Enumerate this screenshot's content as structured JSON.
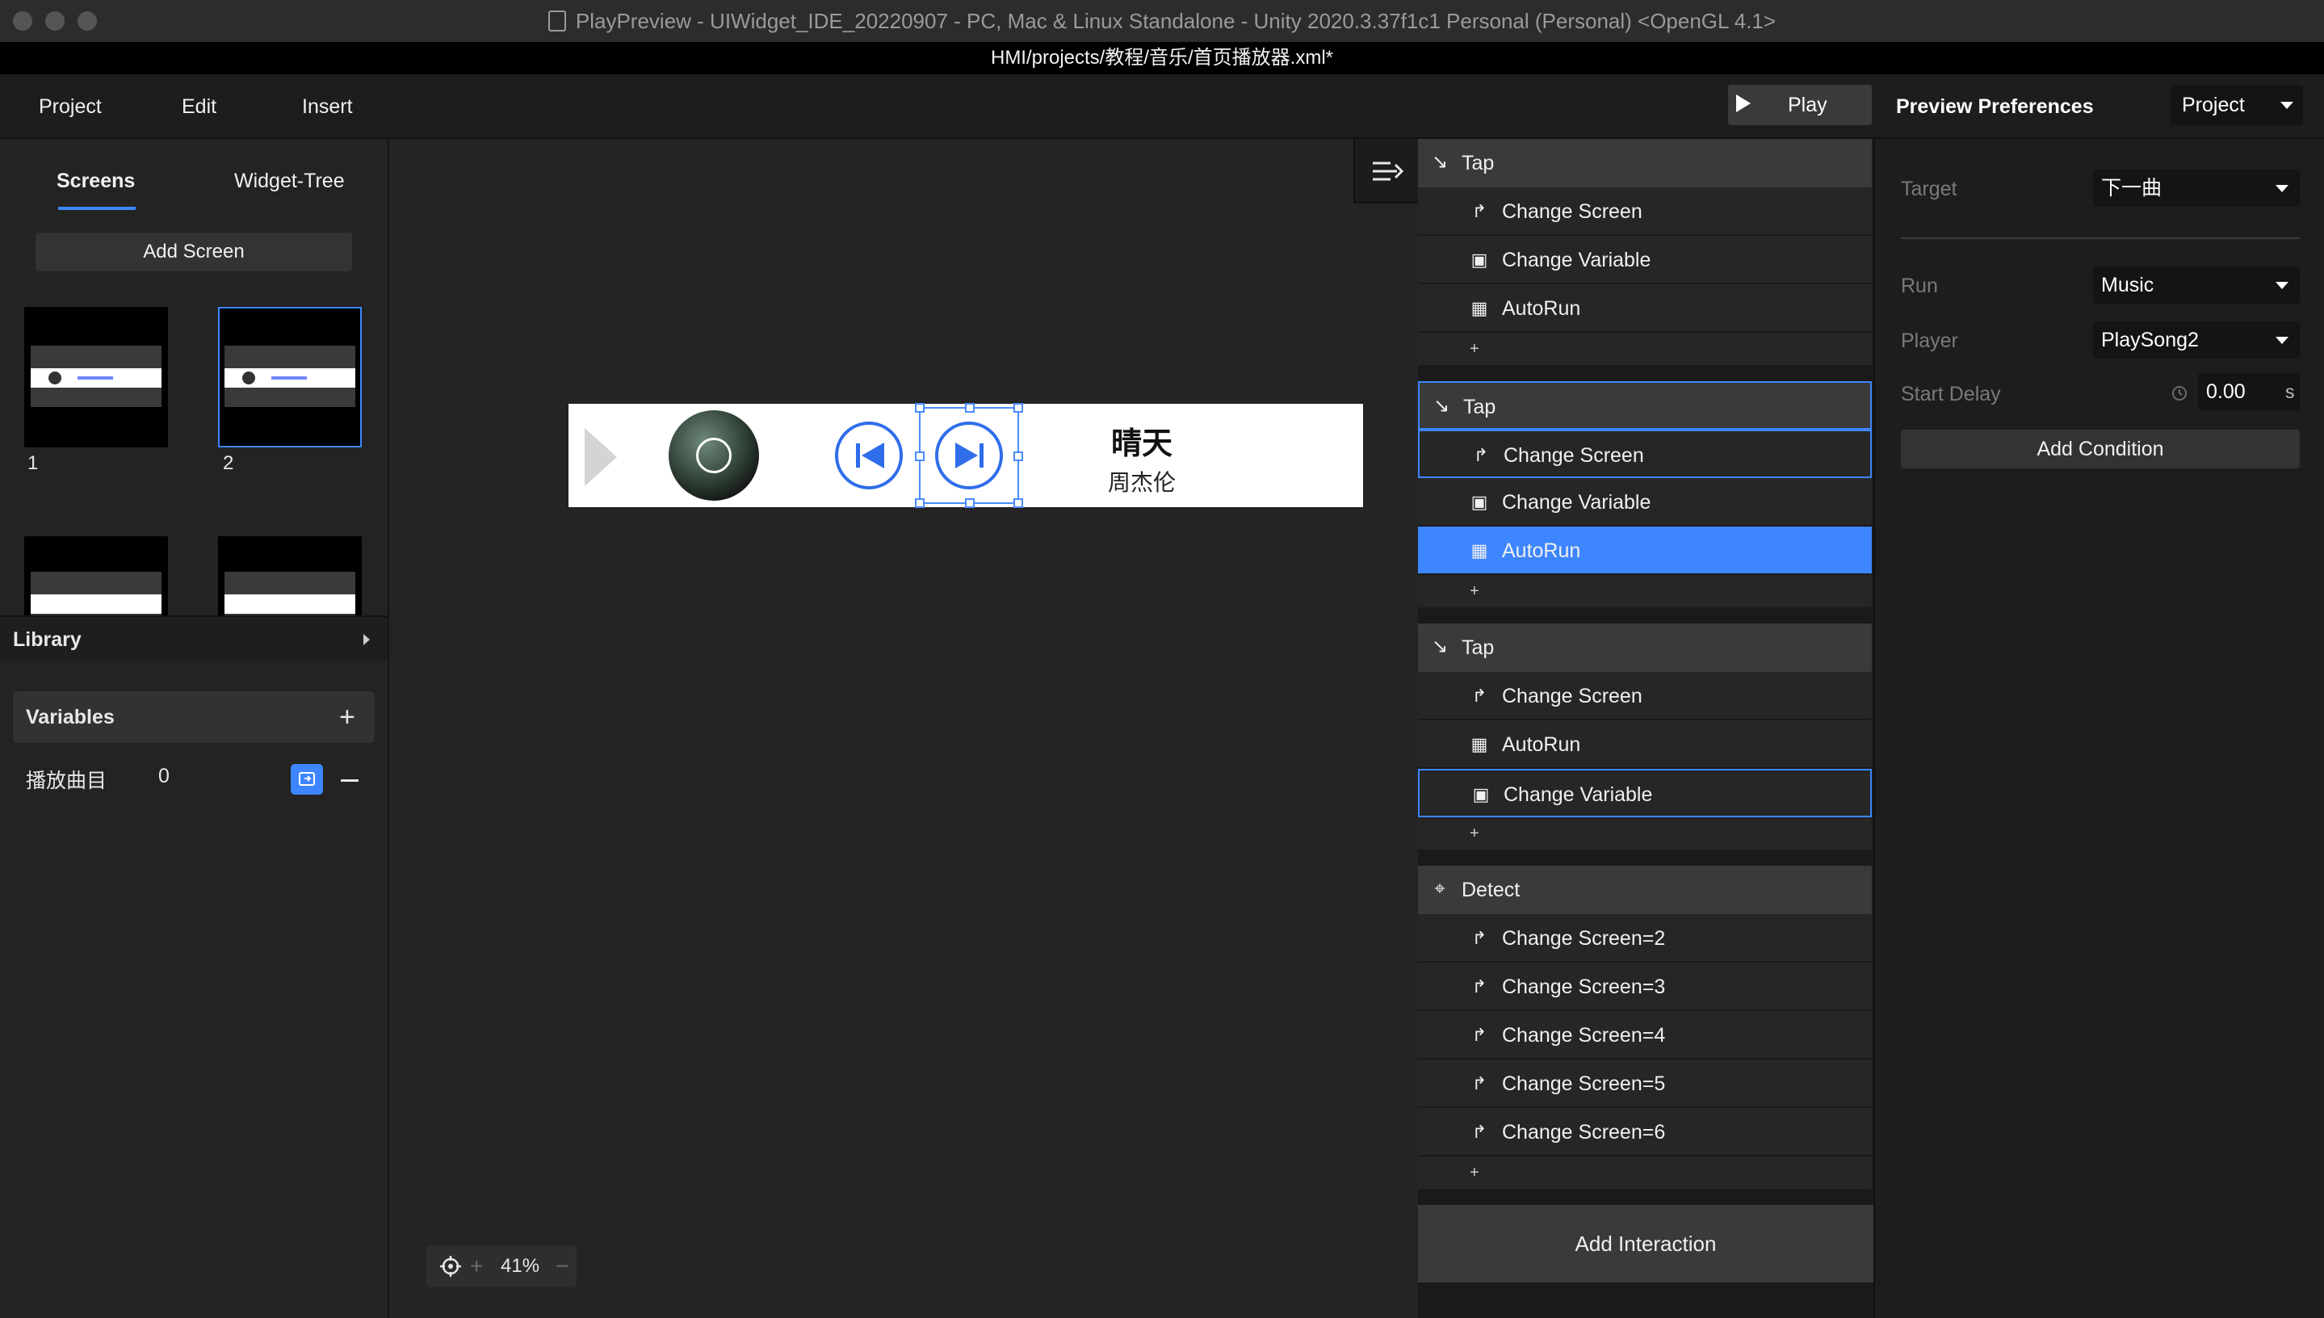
{
  "window": {
    "title": "PlayPreview - UIWidget_IDE_20220907 - PC, Mac & Linux Standalone - Unity 2020.3.37f1c1 Personal (Personal) <OpenGL 4.1>",
    "file_path": "HMI/projects/教程/音乐/首页播放器.xml*"
  },
  "menu": {
    "items": [
      "Project",
      "Edit",
      "Insert"
    ],
    "play_label": "Play",
    "preview_prefs_label": "Preview Preferences",
    "project_select": "Project"
  },
  "left": {
    "tabs": [
      "Screens",
      "Widget-Tree"
    ],
    "add_screen_label": "Add Screen",
    "thumb_numbers": [
      "1",
      "2"
    ],
    "library_label": "Library",
    "variables_label": "Variables",
    "variable": {
      "name": "播放曲目",
      "value": "0"
    }
  },
  "canvas": {
    "song_title": "晴天",
    "song_artist": "周杰伦",
    "zoom": "41%"
  },
  "interactions": {
    "groups": [
      {
        "trigger": "Tap",
        "trigger_icon": "tap-arrow-icon",
        "selected": false,
        "actions": [
          {
            "label": "Change Screen",
            "icon": "change-screen-icon",
            "state": ""
          },
          {
            "label": "Change Variable",
            "icon": "change-variable-icon",
            "state": ""
          },
          {
            "label": "AutoRun",
            "icon": "autorun-icon",
            "state": ""
          }
        ]
      },
      {
        "trigger": "Tap",
        "trigger_icon": "tap-arrow-icon",
        "selected": true,
        "actions": [
          {
            "label": "Change Screen",
            "icon": "change-screen-icon",
            "state": "outlined"
          },
          {
            "label": "Change Variable",
            "icon": "change-variable-icon",
            "state": ""
          },
          {
            "label": "AutoRun",
            "icon": "autorun-icon",
            "state": "highlighted"
          }
        ]
      },
      {
        "trigger": "Tap",
        "trigger_icon": "tap-arrow-icon",
        "selected": false,
        "actions": [
          {
            "label": "Change Screen",
            "icon": "change-screen-icon",
            "state": ""
          },
          {
            "label": "AutoRun",
            "icon": "autorun-icon",
            "state": ""
          },
          {
            "label": "Change Variable",
            "icon": "change-variable-icon",
            "state": "outlined"
          }
        ]
      },
      {
        "trigger": "Detect",
        "trigger_icon": "crosshair-icon",
        "selected": false,
        "actions": [
          {
            "label": "Change Screen=2",
            "icon": "change-screen-icon",
            "state": ""
          },
          {
            "label": "Change Screen=3",
            "icon": "change-screen-icon",
            "state": ""
          },
          {
            "label": "Change Screen=4",
            "icon": "change-screen-icon",
            "state": ""
          },
          {
            "label": "Change Screen=5",
            "icon": "change-screen-icon",
            "state": ""
          },
          {
            "label": "Change Screen=6",
            "icon": "change-screen-icon",
            "state": ""
          }
        ]
      }
    ],
    "add_label": "+",
    "add_interaction_label": "Add Interaction"
  },
  "properties": {
    "target_label": "Target",
    "target_value": "下一曲",
    "run_label": "Run",
    "run_value": "Music",
    "player_label": "Player",
    "player_value": "PlaySong2",
    "start_delay_label": "Start Delay",
    "start_delay_value": "0.00",
    "start_delay_unit": "s",
    "add_condition_label": "Add Condition"
  },
  "colors": {
    "accent": "#3d86ff",
    "panel": "#232323",
    "stage_control": "#2f6dea"
  }
}
